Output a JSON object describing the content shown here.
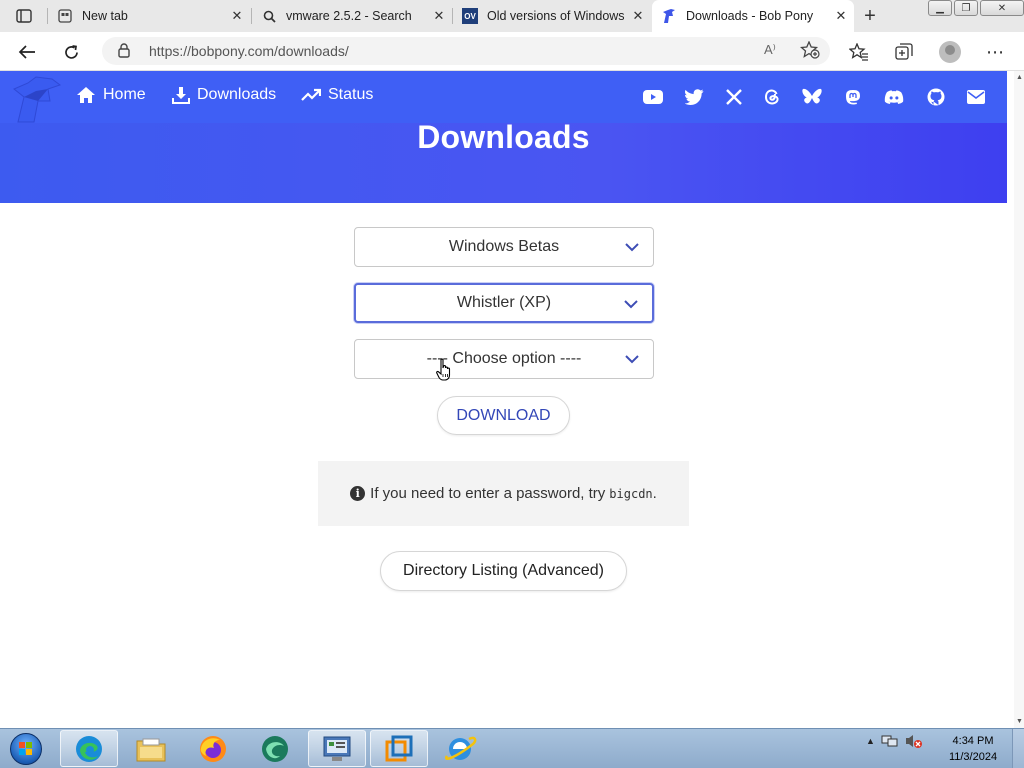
{
  "browser": {
    "tabs": [
      {
        "title": "New tab",
        "icon": "newtab-icon",
        "active": false
      },
      {
        "title": "vmware 2.5.2 - Search",
        "icon": "search-icon",
        "active": false
      },
      {
        "title": "Old versions of Windows",
        "icon": "ov-icon",
        "icon_text": "OV",
        "active": false
      },
      {
        "title": "Downloads - Bob Pony",
        "icon": "bobpony-icon",
        "active": true
      }
    ],
    "new_tab_label": "+",
    "url": "https://bobpony.com/downloads/",
    "read_aloud_label": "A⁾"
  },
  "site": {
    "nav": [
      {
        "label": "Home",
        "icon": "home-icon"
      },
      {
        "label": "Downloads",
        "icon": "download-icon"
      },
      {
        "label": "Status",
        "icon": "trend-icon"
      }
    ],
    "social": [
      "youtube-icon",
      "twitter-icon",
      "x-icon",
      "threads-icon",
      "bluesky-icon",
      "mastodon-icon",
      "discord-icon",
      "github-icon",
      "mail-icon"
    ],
    "heading": "Downloads",
    "brand_color": "#3f5ff5"
  },
  "form": {
    "select1": "Windows Betas",
    "select2": "Whistler (XP)",
    "select3": "---- Choose option ----",
    "download_label": "DOWNLOAD",
    "info_text": "If you need to enter a password, try",
    "info_code": "bigcdn",
    "info_end": ".",
    "dir_label": "Directory Listing (Advanced)"
  },
  "taskbar": {
    "items": [
      "edge-icon",
      "explorer-icon",
      "firefox-icon",
      "app-icon",
      "control-panel-icon",
      "vmware-icon",
      "ie-icon"
    ],
    "time": "4:34 PM",
    "date": "11/3/2024"
  }
}
